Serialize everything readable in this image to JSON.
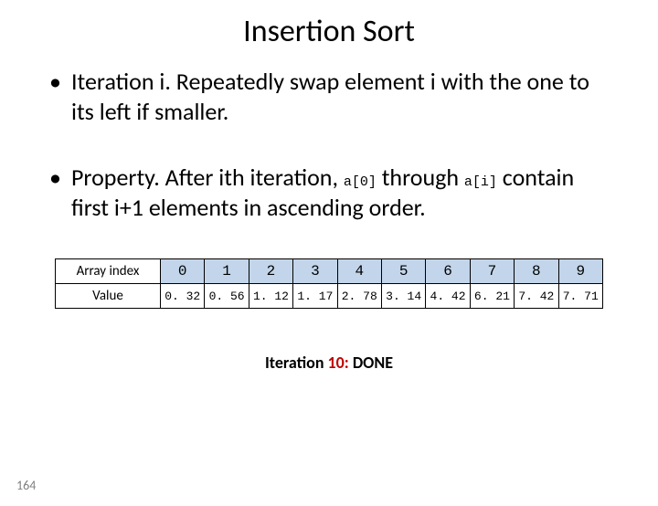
{
  "title": "Insertion Sort",
  "bullet1": {
    "text_a": "Iteration i.  Repeatedly swap element i with the one to its left if smaller."
  },
  "bullet2": {
    "text_a": "Property.  After ith iteration, ",
    "code_a": "a[0]",
    "text_b": " through ",
    "code_b": "a[i]",
    "text_c": " contain first i+1 elements in ascending order."
  },
  "table": {
    "row1_label": "Array index",
    "row2_label": "Value",
    "indices": [
      "0",
      "1",
      "2",
      "3",
      "4",
      "5",
      "6",
      "7",
      "8",
      "9"
    ],
    "values": [
      "0. 32",
      "0. 56",
      "1. 12",
      "1. 17",
      "2. 78",
      "3. 14",
      "4. 42",
      "6. 21",
      "7. 42",
      "7. 71"
    ]
  },
  "iteration": {
    "prefix": "Iteration ",
    "num": "10:",
    "suffix": "  DONE"
  },
  "page_number": "164"
}
